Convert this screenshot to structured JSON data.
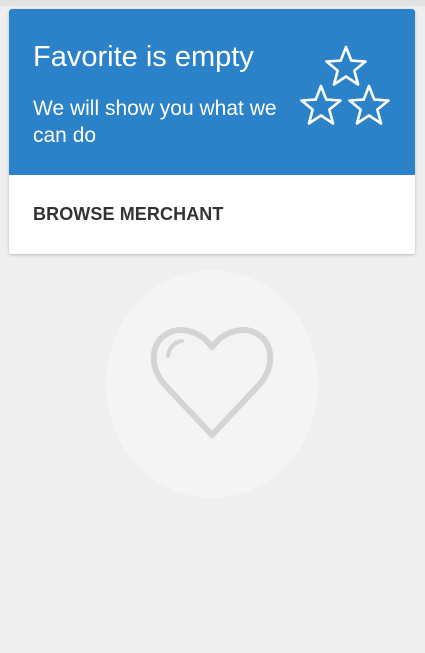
{
  "card": {
    "title": "Favorite is empty",
    "subtitle": "We will show you what we can do",
    "action_label": "BROWSE MERCHANT",
    "header_color": "#2b82c8",
    "decoration_icon": "three-stars-icon"
  },
  "empty_state": {
    "icon": "heart-outline-icon"
  }
}
